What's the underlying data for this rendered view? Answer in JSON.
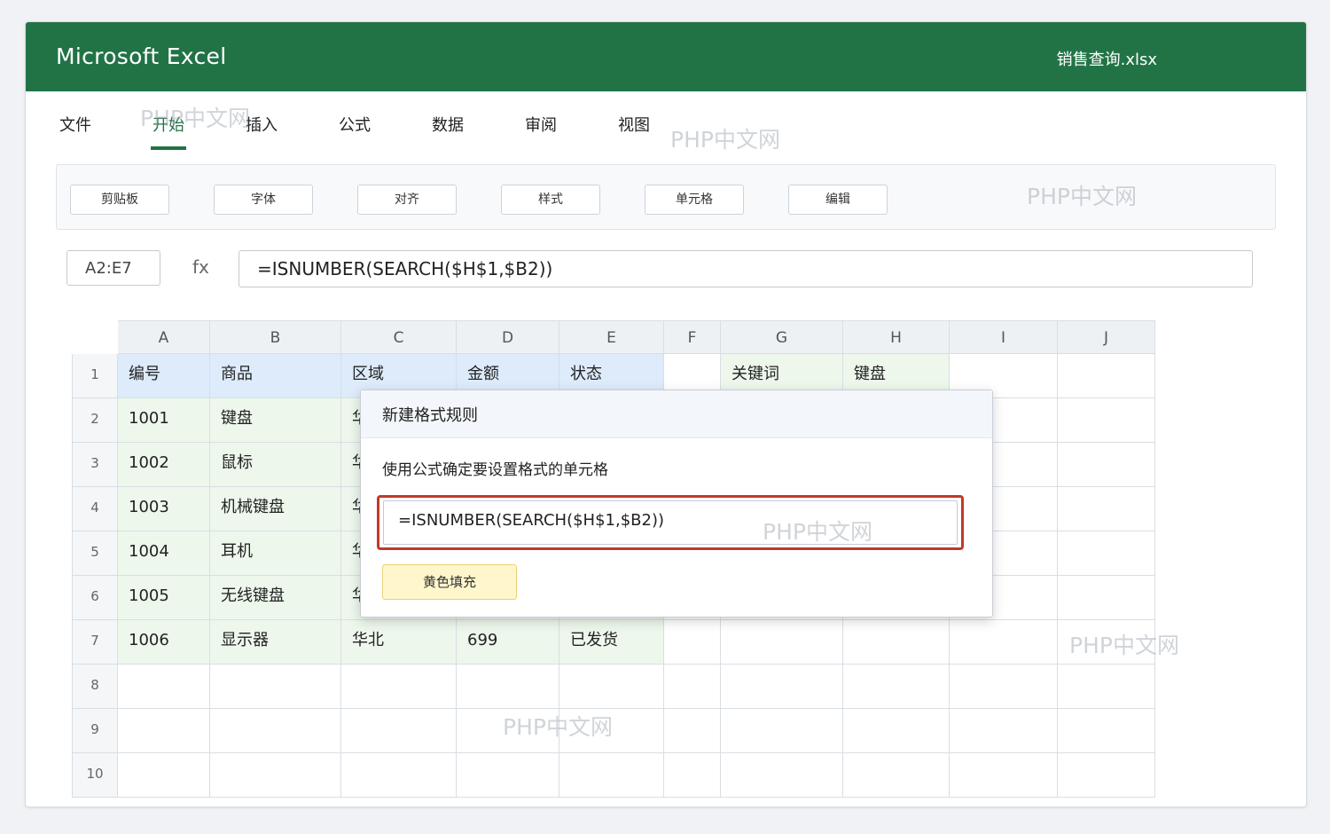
{
  "app": {
    "title": "Microsoft Excel",
    "file_name": "销售查询.xlsx"
  },
  "tabs": [
    "文件",
    "开始",
    "插入",
    "公式",
    "数据",
    "审阅",
    "视图"
  ],
  "active_tab": "开始",
  "ribbon": [
    "剪贴板",
    "字体",
    "对齐",
    "样式",
    "单元格",
    "编辑"
  ],
  "formula_bar": {
    "name_box": "A2:E7",
    "fx_label": "fx",
    "formula": "=ISNUMBER(SEARCH($H$1,$B2))"
  },
  "sheet": {
    "columns": [
      "A",
      "B",
      "C",
      "D",
      "E",
      "F",
      "G",
      "H",
      "I",
      "J"
    ],
    "rows": [
      [
        "编号",
        "商品",
        "区域",
        "金额",
        "状态",
        "",
        "关键词",
        "键盘",
        "",
        ""
      ],
      [
        "1001",
        "键盘",
        "华",
        "",
        "",
        "",
        "",
        "",
        "",
        ""
      ],
      [
        "1002",
        "鼠标",
        "华",
        "",
        "",
        "",
        "",
        "",
        "",
        ""
      ],
      [
        "1003",
        "机械键盘",
        "华",
        "",
        "",
        "",
        "",
        "",
        "",
        ""
      ],
      [
        "1004",
        "耳机",
        "华",
        "",
        "",
        "",
        "",
        "",
        "",
        ""
      ],
      [
        "1005",
        "无线键盘",
        "华",
        "",
        "",
        "",
        "",
        "",
        "",
        ""
      ],
      [
        "1006",
        "显示器",
        "华北",
        "699",
        "已发货",
        "",
        "",
        "",
        "",
        ""
      ],
      [
        "",
        "",
        "",
        "",
        "",
        "",
        "",
        "",
        "",
        ""
      ],
      [
        "",
        "",
        "",
        "",
        "",
        "",
        "",
        "",
        "",
        ""
      ],
      [
        "",
        "",
        "",
        "",
        "",
        "",
        "",
        "",
        "",
        ""
      ]
    ],
    "row_numbers": [
      "1",
      "2",
      "3",
      "4",
      "5",
      "6",
      "7",
      "8",
      "9",
      "10"
    ]
  },
  "dialog": {
    "title": "新建格式规则",
    "description": "使用公式确定要设置格式的单元格",
    "rule_formula": "=ISNUMBER(SEARCH($H$1,$B2))",
    "format_preview": "黄色填充"
  },
  "watermark": "PHP中文网",
  "colors": {
    "excel_green": "#217346",
    "header_fill": "#ddebfb",
    "data_fill": "#edf7ec",
    "highlight_border": "#c0392b",
    "yellow_fill": "#fff6cc"
  }
}
